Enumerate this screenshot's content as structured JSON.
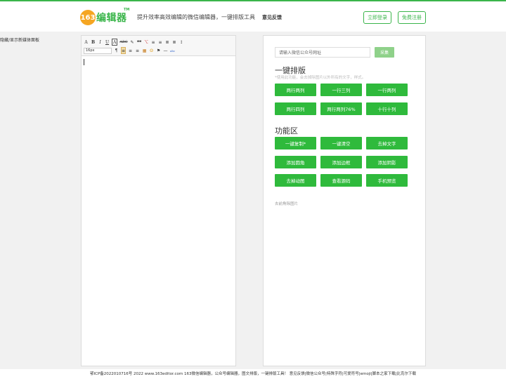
{
  "header": {
    "logo_number": "163",
    "logo_text": "编辑器",
    "logo_tm": "TM",
    "slogan": "提升效率高效编辑的微信编辑器，一键排版工具",
    "feedback": "意见反馈",
    "login": "立即登录",
    "register": "免费注册"
  },
  "toggle_panel": "隐藏/显示新媒体面板",
  "editor": {
    "toolbar_row1": [
      "A",
      "B",
      "I",
      "U",
      "A",
      "ABC",
      "✎",
      "❝❝",
      "⌥",
      "≡",
      "≡",
      "≣",
      "≣",
      "↕"
    ],
    "font_size": "16px",
    "toolbar_row2": [
      "¶",
      "≡",
      "≡",
      "≡",
      "▦",
      "☺",
      "⚑",
      "—",
      "abc"
    ]
  },
  "panel": {
    "url_placeholder": "请输入微信公众号网址",
    "collect": "采集",
    "layout_title": "一键排版",
    "layout_hint": "*使用此功能，会去掉除图片以外所有的文字，样式。",
    "layout_buttons": [
      "两行两列",
      "一行三列",
      "一行两列",
      "两行四列",
      "两行两列76%",
      "十行十列"
    ],
    "func_title": "功能区",
    "func_buttons": [
      "一键复制*",
      "一键清空",
      "去掉文字",
      "添加圆角",
      "添加边框",
      "添加阴影",
      "去掉动图",
      "查看源码",
      "手机预览"
    ],
    "note": "去前角除图片"
  },
  "footer": "鄂ICP备2022010716号 2022 www.163editor.com 163微信编辑器，公众号编辑器，图文排版，一键排版工具！ 意见反馈|微信公众号|特殊字符|可爱符号|emoji|脚本之家下载|比克尔下载",
  "colors": {
    "brand_green": "#2fba3c",
    "logo_orange": "#f5a623"
  }
}
